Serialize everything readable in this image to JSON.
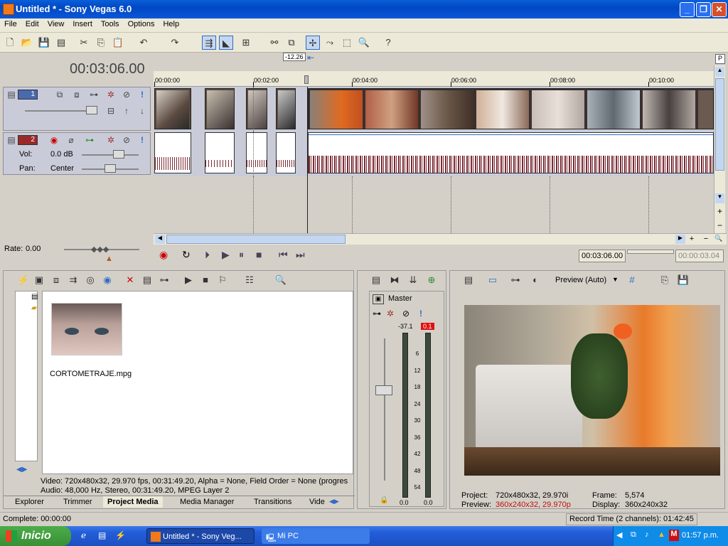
{
  "window": {
    "title": "Untitled * - Sony Vegas 6.0"
  },
  "menu": [
    "File",
    "Edit",
    "View",
    "Insert",
    "Tools",
    "Options",
    "Help"
  ],
  "timecode_main": "00:03:06.00",
  "cursor_marker": "-12.26",
  "tracks": {
    "video": {
      "number": "1"
    },
    "audio": {
      "number": "2",
      "vol_label": "Vol:",
      "vol_value": "0.0 dB",
      "pan_label": "Pan:",
      "pan_value": "Center"
    }
  },
  "ruler_ticks": [
    "00:00:00",
    "00:02:00",
    "00:04:00",
    "00:06:00",
    "00:08:00",
    "00:10:00"
  ],
  "rate": {
    "label": "Rate:",
    "value": "0.00"
  },
  "transport": {
    "position": "00:03:06.00",
    "selection_length": "00:00:03.04"
  },
  "media": {
    "filename": "CORTOMETRAJE.mpg",
    "video_info": "Video: 720x480x32, 29.970 fps, 00:31:49.20, Alpha = None, Field Order = None (progres",
    "audio_info": "Audio: 48,000 Hz, Stereo, 00:31:49.20, MPEG Layer 2",
    "tabs": [
      "Explorer",
      "Trimmer",
      "Project Media",
      "Media Manager",
      "Transitions",
      "Vide"
    ],
    "active_tab": "Project Media"
  },
  "mixer": {
    "label": "Master",
    "peak_left": "-37.1",
    "peak_right": "0.1",
    "scale": [
      "6",
      "12",
      "18",
      "24",
      "30",
      "36",
      "42",
      "48",
      "54"
    ],
    "bottom_left": "0.0",
    "bottom_right": "0.0"
  },
  "preview": {
    "mode": "Preview (Auto)",
    "project_label": "Project:",
    "project_value": "720x480x32, 29.970i",
    "preview_label": "Preview:",
    "preview_value": "360x240x32, 29.970p",
    "frame_label": "Frame:",
    "frame_value": "5,574",
    "display_label": "Display:",
    "display_value": "360x240x32"
  },
  "status": {
    "left": "Complete: 00:00:00",
    "right": "Record Time (2 channels): 01:42:45"
  },
  "taskbar": {
    "start": "Inicio",
    "items": [
      "Untitled * - Sony Veg...",
      "Mi PC"
    ],
    "clock": "01:57 p.m."
  },
  "colors": {
    "accent": "#316ac5",
    "titlebar": "#0a57d6",
    "waveform": "#7a2a33",
    "peak_red": "#e01010"
  }
}
